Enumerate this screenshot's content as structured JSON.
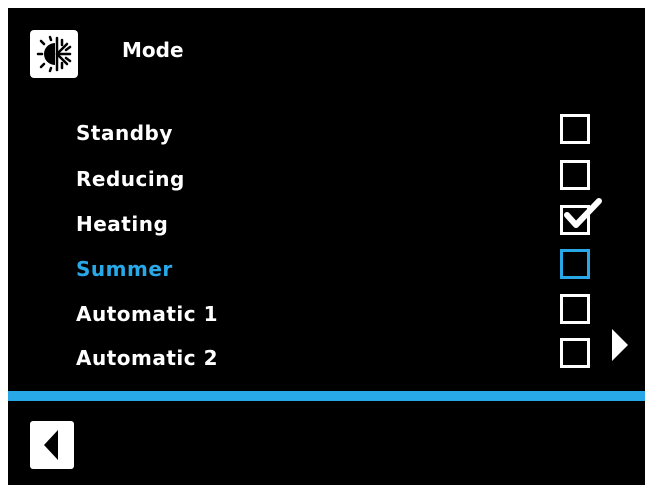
{
  "header": {
    "title": "Mode",
    "icon": "heat-cool-mode-icon"
  },
  "mode_list": {
    "items": [
      {
        "label": "Standby",
        "checked": false,
        "selected": false
      },
      {
        "label": "Reducing",
        "checked": false,
        "selected": false
      },
      {
        "label": "Heating",
        "checked": true,
        "selected": false
      },
      {
        "label": "Summer",
        "checked": false,
        "selected": true
      },
      {
        "label": "Automatic 1",
        "checked": false,
        "selected": false
      },
      {
        "label": "Automatic 2",
        "checked": false,
        "selected": false
      }
    ],
    "more_icon": "triangle-right-icon"
  },
  "footer": {
    "back_icon": "triangle-left-icon"
  },
  "colors": {
    "background": "#000000",
    "foreground": "#ffffff",
    "accent": "#29a8e7"
  }
}
